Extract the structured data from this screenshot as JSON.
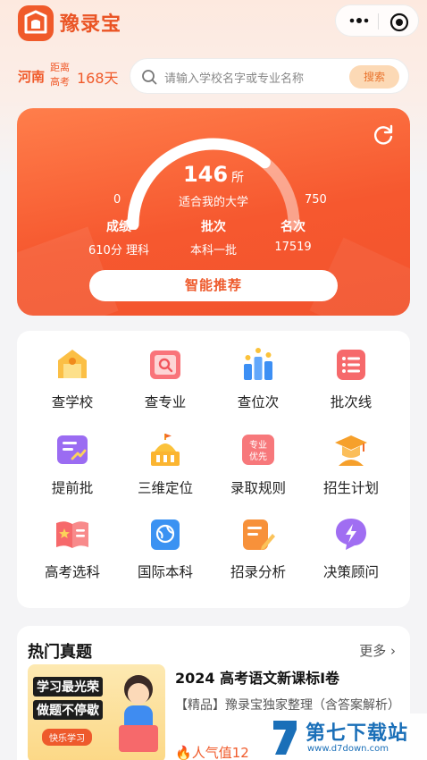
{
  "app": {
    "name": "豫录宝"
  },
  "header": {
    "more_icon": "more-dots-icon",
    "close_icon": "target-icon"
  },
  "location": {
    "province": "河南",
    "countdown_label": "距离高考",
    "days": "168天"
  },
  "search": {
    "placeholder": "请输入学校名字或专业名称",
    "button": "搜索"
  },
  "hero": {
    "count": "146",
    "unit": "所",
    "subtitle": "适合我的大学",
    "min": "0",
    "max": "750",
    "gauge_fraction": 0.72,
    "stats": [
      {
        "label": "成绩",
        "value": "610分 理科"
      },
      {
        "label": "批次",
        "value": "本科一批"
      },
      {
        "label": "名次",
        "value": "17519"
      }
    ],
    "button": "智能推荐"
  },
  "features": [
    {
      "label": "查学校",
      "icon": "school-icon"
    },
    {
      "label": "查专业",
      "icon": "major-search-icon"
    },
    {
      "label": "查位次",
      "icon": "rank-bars-icon"
    },
    {
      "label": "批次线",
      "icon": "batch-list-icon"
    },
    {
      "label": "提前批",
      "icon": "early-batch-icon"
    },
    {
      "label": "三维定位",
      "icon": "building-icon"
    },
    {
      "label": "录取规则",
      "icon": "major-priority-icon",
      "badge": "专业优先"
    },
    {
      "label": "招生计划",
      "icon": "graduation-cap-icon"
    },
    {
      "label": "高考选科",
      "icon": "book-star-icon"
    },
    {
      "label": "国际本科",
      "icon": "globe-book-icon"
    },
    {
      "label": "招录分析",
      "icon": "edit-doc-icon"
    },
    {
      "label": "决策顾问",
      "icon": "consultant-bolt-icon"
    }
  ],
  "hot": {
    "title": "热门真题",
    "more": "更多",
    "item": {
      "thumb_line1": "学习最光荣",
      "thumb_line2": "做题不停歇",
      "thumb_tag": "快乐学习",
      "headline": "2024 高考语文新课标I卷",
      "desc": "【精品】豫录宝独家整理（含答案解析）",
      "popularity": "人气值12"
    }
  },
  "watermark": {
    "title": "第七下载站",
    "url": "www.d7down.com"
  },
  "colors": {
    "accent": "#f05a2a",
    "card": "#f6582f"
  }
}
